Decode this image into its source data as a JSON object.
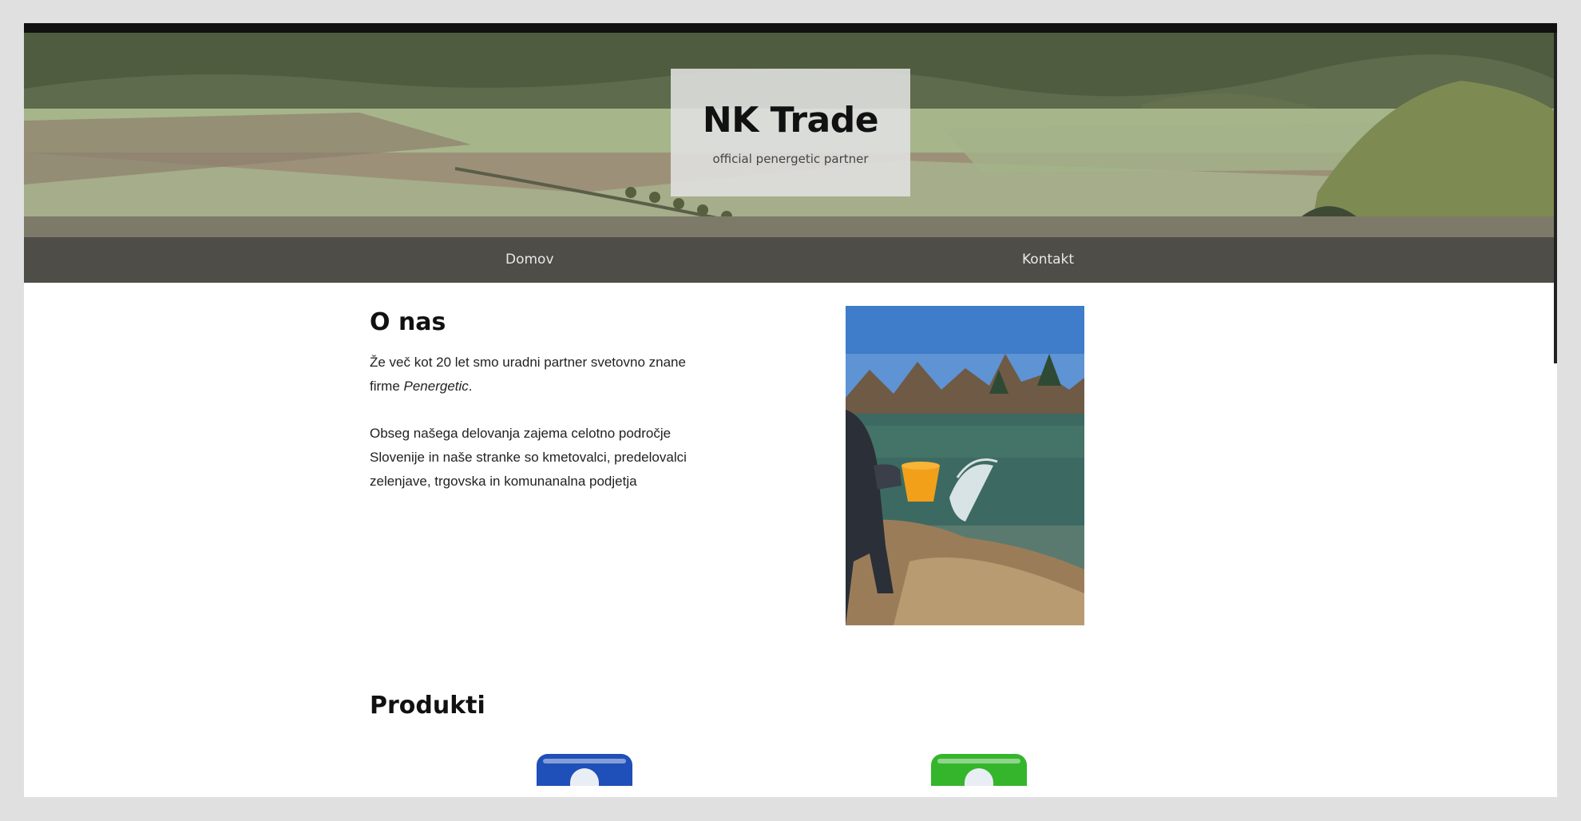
{
  "header": {
    "site_title": "NK Trade",
    "tagline": "official penergetic partner",
    "hero_image": "aerial countryside fields and forest"
  },
  "nav": {
    "items": [
      {
        "label": "Domov"
      },
      {
        "label": "Kontakt"
      }
    ]
  },
  "about": {
    "title": "O nas",
    "paragraph1_pre": "Že več kot 20 let smo uradni partner svetovno znane firme ",
    "paragraph1_brand": "Penergetic",
    "paragraph1_post": ".",
    "paragraph2": "Obseg našega delovanja zajema celotno področje Slovenije in naše stranke so kmetovalci, predelovalci zelenjave, trgovska in komunanalna podjetja",
    "photo": "person pouring water from orange bucket into pond"
  },
  "products": {
    "title": "Produkti",
    "items": [
      {
        "name": "blue-product-bucket",
        "color": "#1f4fb8"
      },
      {
        "name": "green-product-bucket",
        "color": "#34b52c"
      }
    ]
  },
  "colors": {
    "nav_background": "#3c3c3a",
    "page_background": "#e0e0e0",
    "content_background": "#ffffff"
  }
}
